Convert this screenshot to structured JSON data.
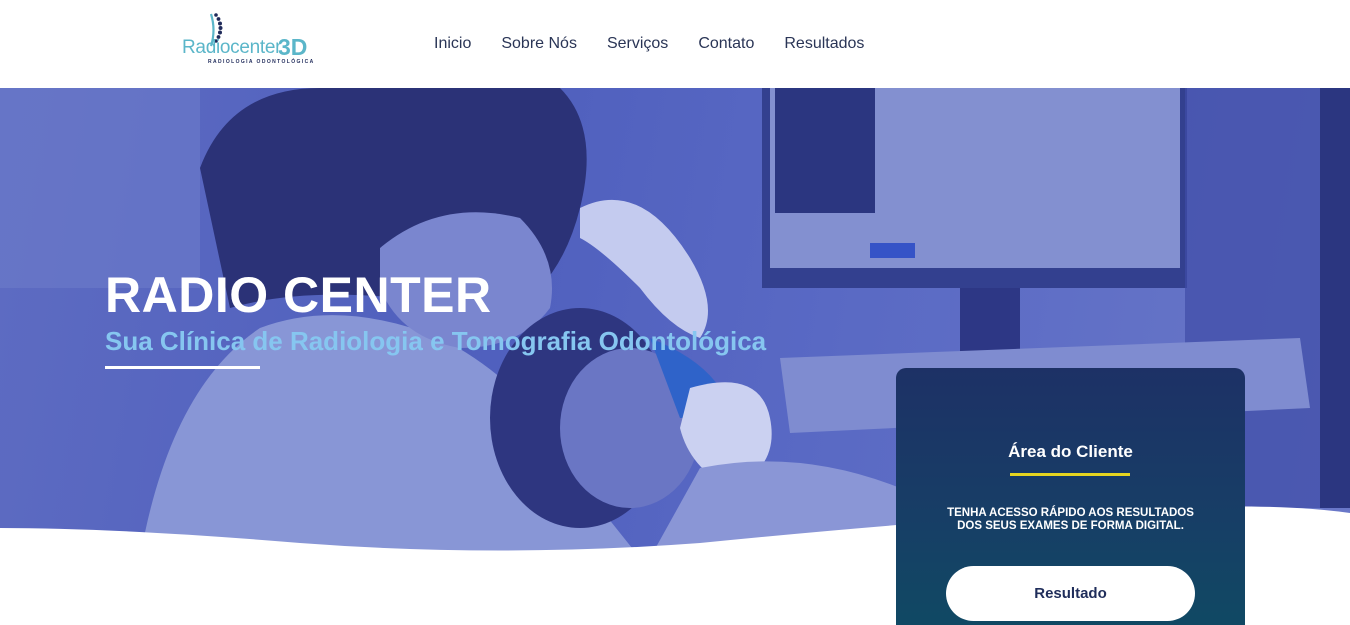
{
  "brand": {
    "name": "Radiocenter",
    "suffix": "3D",
    "tagline": "RADIOLOGIA ODONTOLÓGICA",
    "mark_icon": "spine-dots-icon"
  },
  "nav": {
    "items": [
      {
        "label": "Inicio"
      },
      {
        "label": "Sobre Nós"
      },
      {
        "label": "Serviços"
      },
      {
        "label": "Contato"
      },
      {
        "label": "Resultados"
      }
    ]
  },
  "hero": {
    "title": "RADIO CENTER",
    "subtitle": "Sua Clínica de Radiologia e Tomografia Odontológica"
  },
  "client_area": {
    "title": "Área do Cliente",
    "description": "TENHA ACESSO RÁPIDO AOS RESULTADOS DOS SEUS EXAMES DE FORMA DIGITAL.",
    "button_label": "Resultado"
  },
  "colors": {
    "brand_teal": "#5bb6c9",
    "hero_overlay": "#5565c0",
    "subtitle_blue": "#86c6f0",
    "card_navy": "#1d3166",
    "accent_yellow": "#e6d520"
  }
}
